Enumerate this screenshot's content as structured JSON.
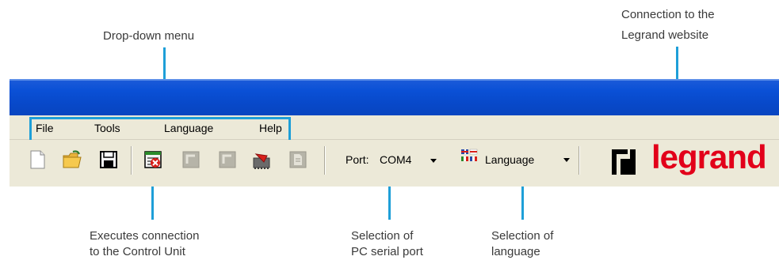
{
  "callouts": {
    "dropdown": "Drop-down menu",
    "website_line1": "Connection to the",
    "website_line2": "Legrand website",
    "connect_line1": "Executes connection",
    "connect_line2": "to the Control Unit",
    "serial_line1": "Selection of",
    "serial_line2": "PC serial port",
    "language_line1": "Selection of",
    "language_line2": "language"
  },
  "menu": {
    "items": [
      "File",
      "Tools",
      "Language",
      "Help"
    ]
  },
  "toolbar": {
    "buttons": [
      "new-file-icon",
      "open-folder-icon",
      "save-icon",
      "connect-icon",
      "disabled-icon",
      "disabled-icon",
      "send-icon",
      "document-icon"
    ],
    "port_label": "Port:",
    "port_value": "COM4",
    "language_value": "Language"
  },
  "logo": {
    "text": "legrand"
  },
  "colors": {
    "callout_line": "#1e9fd8",
    "titlebar": "#0a50d6",
    "chrome": "#ece9d8",
    "logo_red": "#e2001a"
  }
}
